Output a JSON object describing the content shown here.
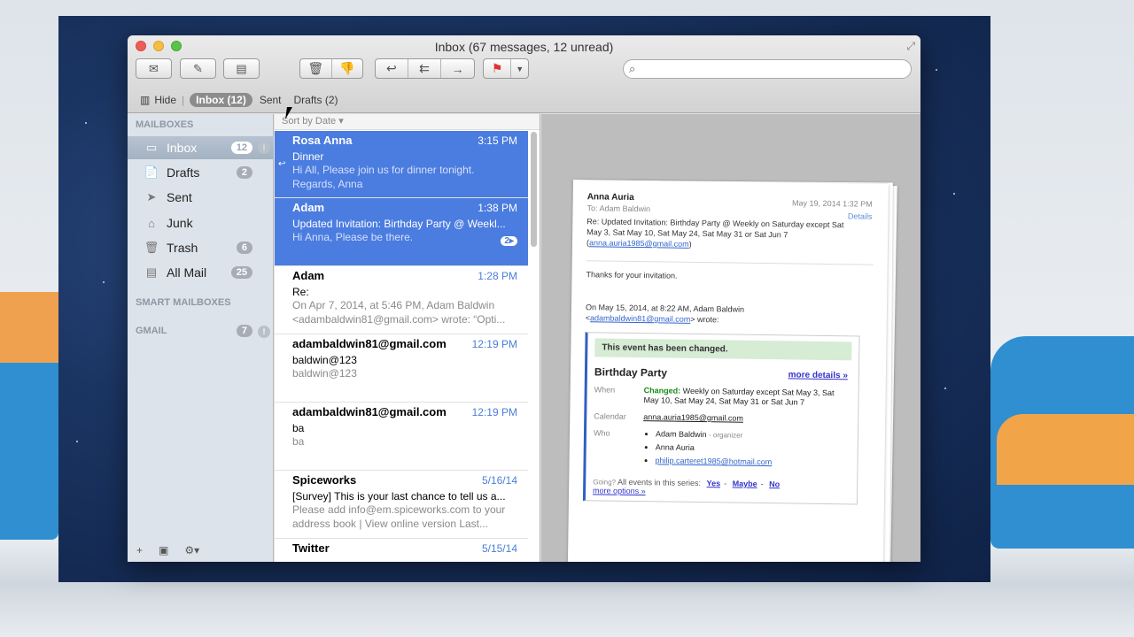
{
  "window": {
    "title": "Inbox (67 messages, 12 unread)"
  },
  "toolbar": {
    "search_placeholder": ""
  },
  "favorites": {
    "hide": "Hide",
    "inbox": "Inbox (12)",
    "sent": "Sent",
    "drafts": "Drafts (2)"
  },
  "sidebar": {
    "mailboxes_header": "MAILBOXES",
    "items": [
      {
        "label": "Inbox",
        "icon": "inbox-icon",
        "badge": "12"
      },
      {
        "label": "Drafts",
        "icon": "drafts-icon",
        "badge": "2"
      },
      {
        "label": "Sent",
        "icon": "sent-icon",
        "badge": ""
      },
      {
        "label": "Junk",
        "icon": "junk-icon",
        "badge": ""
      },
      {
        "label": "Trash",
        "icon": "trash-icon",
        "badge": "6"
      },
      {
        "label": "All Mail",
        "icon": "all-mail-icon",
        "badge": "25"
      }
    ],
    "smart_header": "SMART MAILBOXES",
    "gmail_header": "GMAIL",
    "gmail_badge": "7"
  },
  "list": {
    "sort_label": "Sort by Date ▾",
    "messages": [
      {
        "from": "Rosa Anna",
        "time": "3:15 PM",
        "subject": "Dinner",
        "preview": "Hi All, Please join us for dinner tonight. Regards, Anna"
      },
      {
        "from": "Adam",
        "time": "1:38 PM",
        "subject": "Updated Invitation: Birthday Party @ Weekl...",
        "preview": "Hi Anna, Please be there.",
        "thread": "2▸"
      },
      {
        "from": "Adam",
        "time": "1:28 PM",
        "subject": "Re:",
        "preview": "On Apr 7, 2014, at 5:46 PM, Adam Baldwin <adambaldwin81@gmail.com> wrote: “Opti..."
      },
      {
        "from": "adambaldwin81@gmail.com",
        "time": "12:19 PM",
        "subject": "baldwin@123",
        "preview": "baldwin@123"
      },
      {
        "from": "adambaldwin81@gmail.com",
        "time": "12:19 PM",
        "subject": "ba",
        "preview": "ba"
      },
      {
        "from": "Spiceworks",
        "time": "5/16/14",
        "subject": "[Survey] This is your last chance to tell us a...",
        "preview": "Please add info@em.spiceworks.com to your address book | View online version Last..."
      },
      {
        "from": "Twitter",
        "time": "5/15/14",
        "subject": "",
        "preview": ""
      }
    ]
  },
  "preview": {
    "from": "Anna Auria",
    "date": "May 19, 2014   1:32 PM",
    "details": "Details",
    "to": "To:  Adam Baldwin",
    "subject": "Re: Updated Invitation: Birthday Party @ Weekly on Saturday except Sat May 3, Sat May 10, Sat May 24, Sat May 31 or Sat Jun 7",
    "subject_email": "anna.auria1985@gmail.com",
    "body1": "Thanks for your invitation.",
    "quote_intro": "On May 15, 2014, at 8:22 AM, Adam Baldwin",
    "quote_email": "adambaldwin81@gmail.com",
    "quote_wrote": "> wrote:",
    "banner": "This event has been changed.",
    "event_title": "Birthday Party",
    "more_details": "more details »",
    "when_label": "When",
    "changed_label": "Changed:",
    "when_value": "Weekly on Saturday except Sat May 3, Sat May 10, Sat May 24, Sat May 31 or Sat Jun 7",
    "calendar_label": "Calendar",
    "calendar_value": "anna.auria1985@gmail.com",
    "who_label": "Who",
    "who1": "Adam Baldwin",
    "who1_role": "- organizer",
    "who2": "Anna Auria",
    "who3": "philip.carteret1985@hotmail.com",
    "going_label": "Going?",
    "going_text": "All events in this series:",
    "yes": "Yes",
    "maybe": "Maybe",
    "no": "No",
    "more_options": "more options »"
  }
}
